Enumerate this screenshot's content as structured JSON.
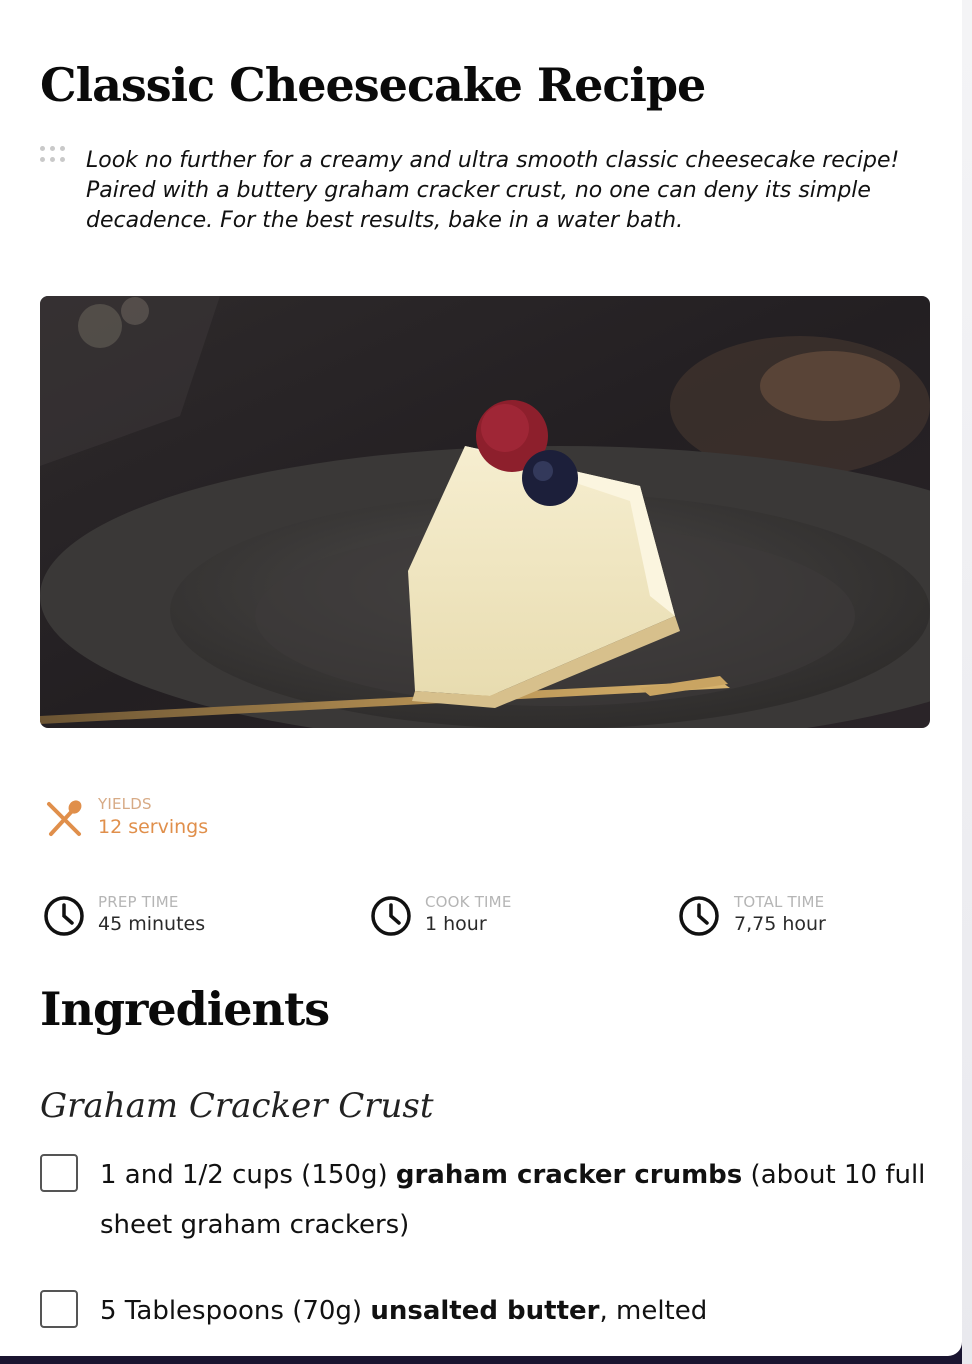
{
  "recipe": {
    "title": "Classic Cheesecake Recipe",
    "summary": "Look no further for a creamy and ultra smooth classic cheesecake recipe! Paired with a buttery graham cracker crust, no one can deny its simple decadence. For the best results, bake in a water bath."
  },
  "details": {
    "yields": {
      "label": "YIELDS",
      "value": "12 servings",
      "icon": "utensils-icon"
    },
    "prep": {
      "label": "PREP TIME",
      "value": "45 minutes",
      "icon": "clock-icon"
    },
    "cook": {
      "label": "COOK TIME",
      "value": "1 hour",
      "icon": "clock-icon"
    },
    "total": {
      "label": "TOTAL TIME",
      "value": "7,75 hour",
      "icon": "clock-icon"
    }
  },
  "ingredients": {
    "heading": "Ingredients",
    "group_title": "Graham Cracker Crust",
    "items": [
      {
        "before": "1 and 1/2 cups (150g) ",
        "bold": "graham cracker crumbs",
        "after": " (about 10 full sheet graham crackers)",
        "checked": false
      },
      {
        "before": "5 Tablespoons (70g) ",
        "bold": "unsalted butter",
        "after": ", melted",
        "checked": false
      }
    ]
  },
  "colors": {
    "accent": "#e08f4b",
    "accent_light": "#d7aa85",
    "label_gray": "#b5b5b5"
  }
}
